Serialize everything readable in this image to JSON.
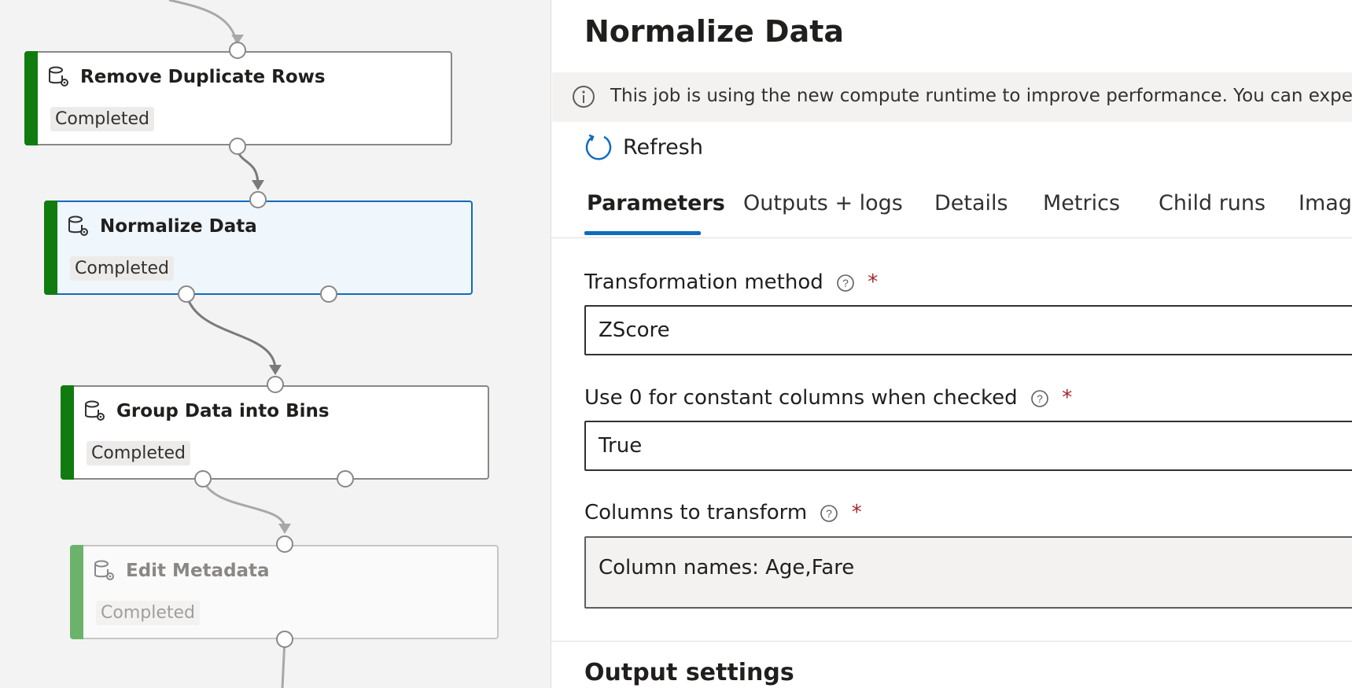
{
  "pipeline": {
    "nodes": [
      {
        "title": "Remove Duplicate Rows",
        "status": "Completed"
      },
      {
        "title": "Normalize Data",
        "status": "Completed"
      },
      {
        "title": "Group Data into Bins",
        "status": "Completed"
      },
      {
        "title": "Edit Metadata",
        "status": "Completed"
      }
    ],
    "icon": "database-gear-icon"
  },
  "panel": {
    "title": "Normalize Data",
    "banner_text": "This job is using the new compute runtime to improve performance. You can expect to see",
    "refresh_label": "Refresh",
    "tabs": [
      "Parameters",
      "Outputs + logs",
      "Details",
      "Metrics",
      "Child runs",
      "Images"
    ],
    "active_tab": "Parameters",
    "fields": [
      {
        "label": "Transformation method",
        "value": "ZScore",
        "required": "*"
      },
      {
        "label": "Use 0 for constant columns when checked",
        "value": "True",
        "required": "*"
      },
      {
        "label": "Columns to transform",
        "value": "Column names: Age,Fare",
        "required": "*"
      }
    ],
    "output_section_title": "Output settings"
  },
  "colors": {
    "accent": "#0f6cbd",
    "completed_bar": "#107c10",
    "required": "#a4262c"
  }
}
